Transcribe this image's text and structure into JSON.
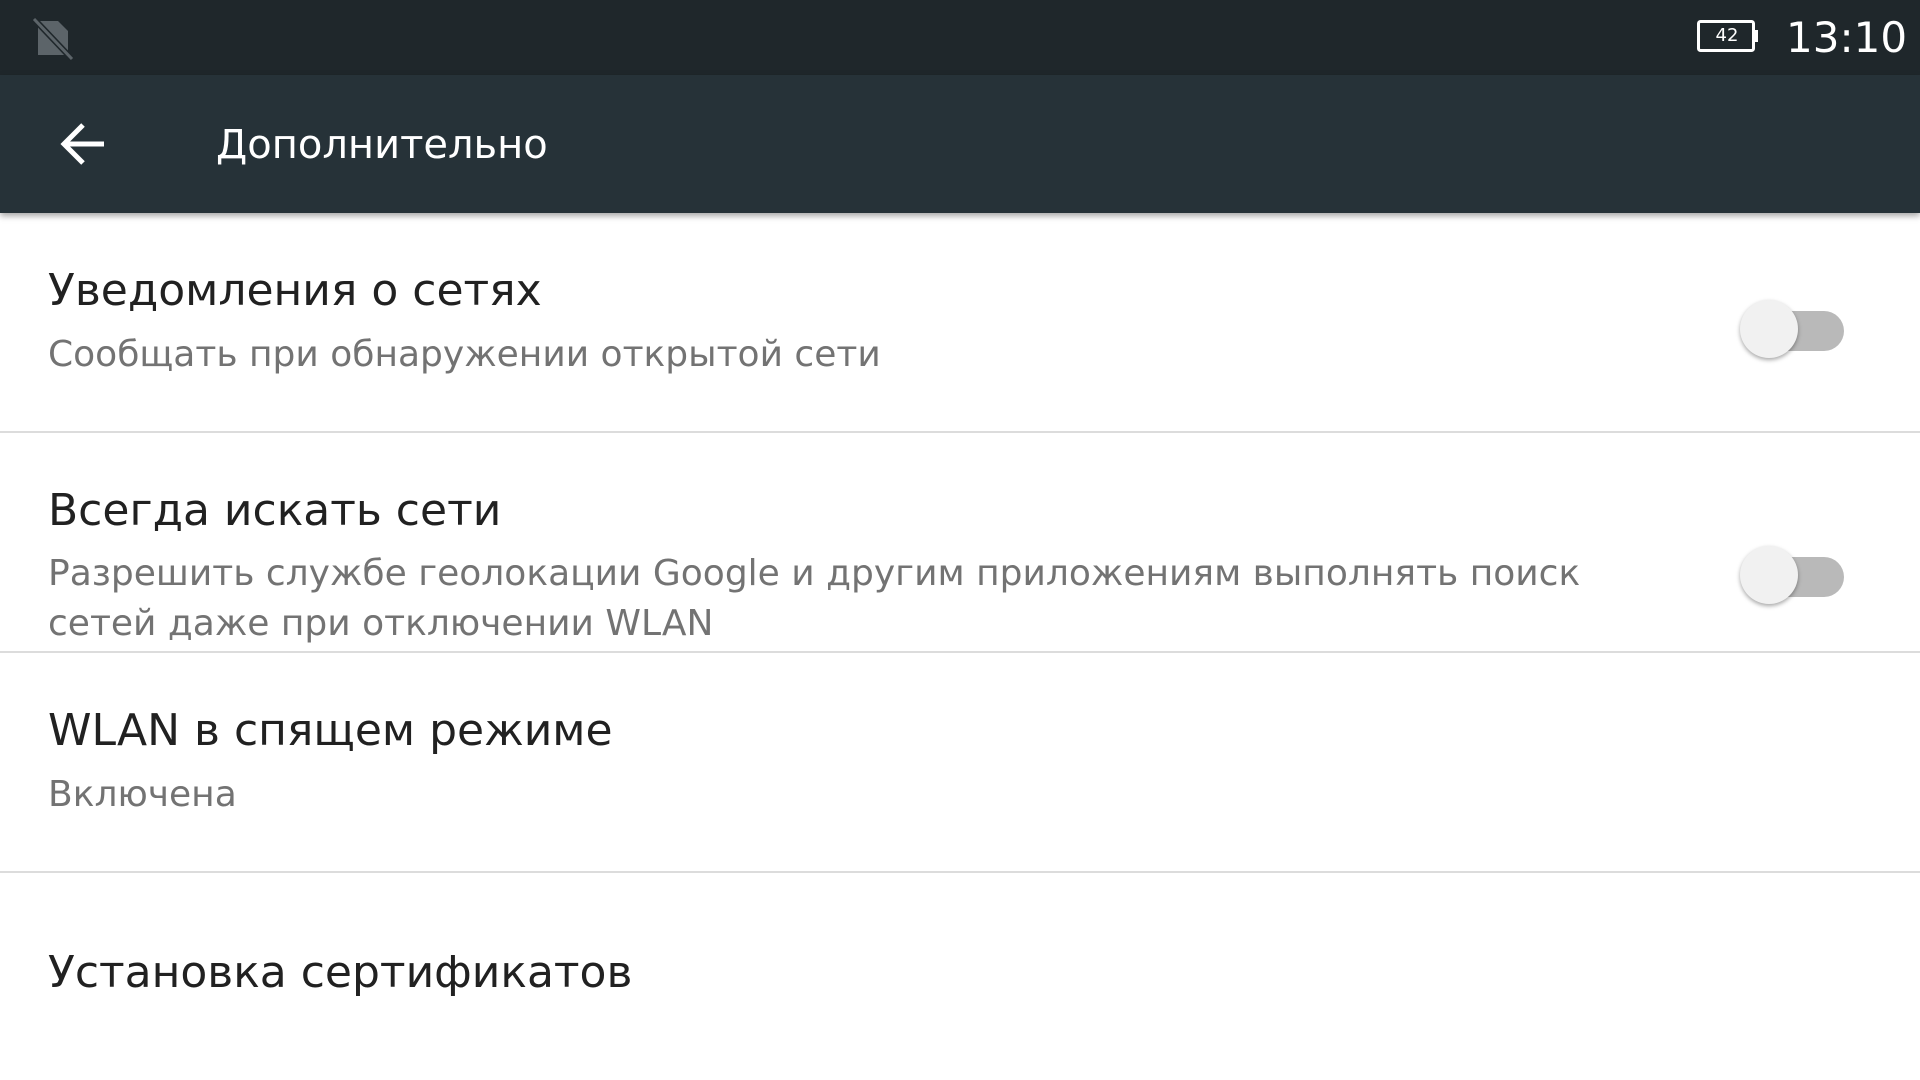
{
  "status_bar": {
    "sim_icon": "no-sim-icon",
    "battery_level": "42",
    "time": "13:10"
  },
  "app_bar": {
    "back_icon": "arrow-left-icon",
    "title": "Дополнительно"
  },
  "settings": [
    {
      "title": "Уведомления о сетях",
      "summary": "Сообщать при обнаружении открытой сети",
      "toggle_on": false
    },
    {
      "title": "Всегда искать сети",
      "summary": "Разрешить службе геолокации Google и другим приложениям выполнять поиск сетей даже при отключении WLAN",
      "toggle_on": false
    },
    {
      "title": "WLAN в спящем режиме",
      "summary": "Включена"
    },
    {
      "title": "Установка сертификатов"
    }
  ],
  "colors": {
    "status_bar": "#1f272b",
    "app_bar": "#263238",
    "switch_off_track": "#b9b9b9",
    "switch_off_thumb": "#f1f1f1"
  }
}
